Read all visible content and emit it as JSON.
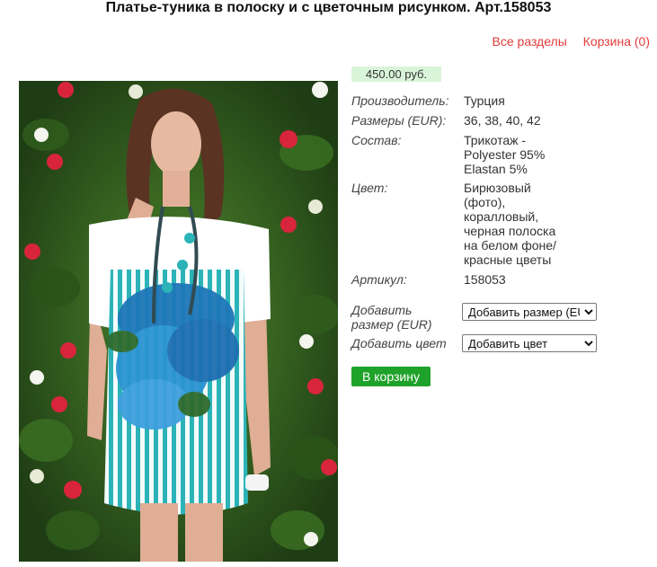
{
  "page": {
    "title": "Платье-туника в полоску и с цветочным рисунком. Арт.158053"
  },
  "nav": {
    "all_sections": "Все разделы",
    "cart": "Корзина (0)"
  },
  "product": {
    "price": "450.00 руб.",
    "specs": [
      {
        "label": "Производитель:",
        "value": "Турция"
      },
      {
        "label": "Размеры (EUR):",
        "value": "36, 38, 40, 42"
      },
      {
        "label": "Состав:",
        "value": "Трикотаж - Polyester 95% Elastan 5%"
      },
      {
        "label": "Цвет:",
        "value": "Бирюзовый (фото), коралловый, черная полоска на белом фоне/ красные цветы"
      },
      {
        "label": "Артикул:",
        "value": "158053"
      }
    ],
    "size_label": "Добавить размер (EUR)",
    "size_select": "Добавить размер (EUR)",
    "color_label": "Добавить цвет",
    "color_select": "Добавить цвет",
    "add_to_cart": "В корзину"
  },
  "colors": {
    "accent_link": "#e23b3b",
    "button": "#1fa22a",
    "price_bg": "#d9f5d9"
  },
  "icons": {
    "select_arrow": "chevron-down-icon"
  }
}
